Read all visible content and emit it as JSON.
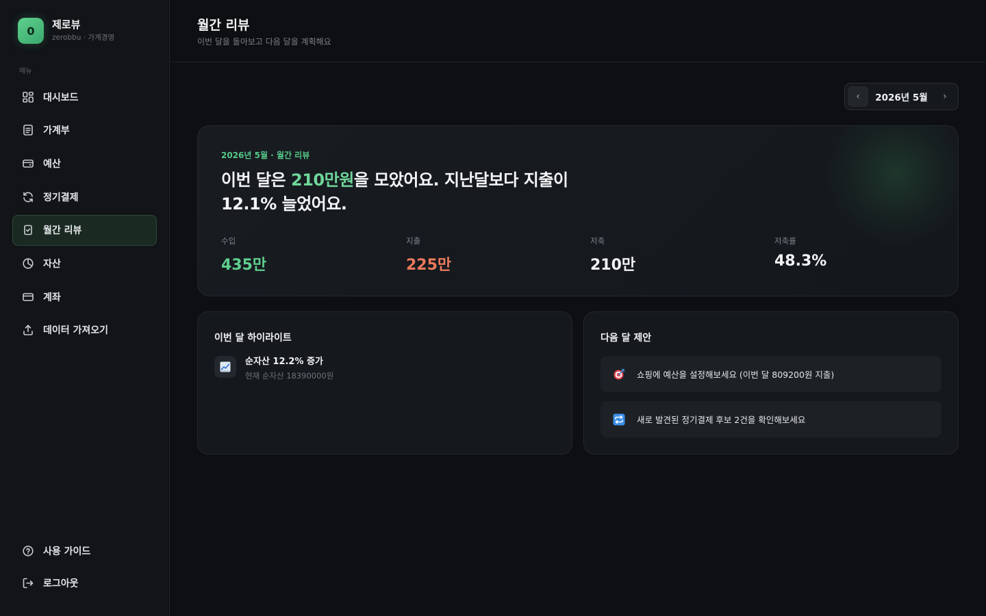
{
  "brand": {
    "logo_letter": "0",
    "name": "제로뷰",
    "subtitle": "zerobbu · 가계경영"
  },
  "sidebar": {
    "menu_label": "메뉴",
    "items": [
      {
        "label": "대시보드",
        "icon": "grid-icon"
      },
      {
        "label": "가계부",
        "icon": "ledger-icon"
      },
      {
        "label": "예산",
        "icon": "wallet-icon"
      },
      {
        "label": "정기결제",
        "icon": "refresh-icon"
      },
      {
        "label": "월간 리뷰",
        "icon": "checklist-icon",
        "active": true
      },
      {
        "label": "자산",
        "icon": "pie-icon"
      },
      {
        "label": "계좌",
        "icon": "card-icon"
      },
      {
        "label": "데이터 가져오기",
        "icon": "upload-icon"
      }
    ],
    "bottom_items": [
      {
        "label": "사용 가이드",
        "icon": "help-icon"
      },
      {
        "label": "로그아웃",
        "icon": "logout-icon"
      }
    ]
  },
  "header": {
    "title": "월간 리뷰",
    "subtitle": "이번 달을 돌아보고 다음 달을 계획해요"
  },
  "month_picker": {
    "label": "2026년 5월",
    "prev": "‹",
    "next": "›"
  },
  "hero": {
    "eyebrow": "2026년 5월 · 월간 리뷰",
    "headline_pre": "이번 달은 ",
    "headline_amount": "210만원",
    "headline_post": "을 모았어요. 지난달보다 지출이 12.1% 늘었어요.",
    "stats": [
      {
        "label": "수입",
        "value": "435만",
        "tone": "green"
      },
      {
        "label": "지출",
        "value": "225만",
        "tone": "red"
      },
      {
        "label": "저축",
        "value": "210만",
        "tone": "neutral"
      },
      {
        "label": "저축률",
        "value": "48.3%",
        "tone": "neutral"
      }
    ]
  },
  "highlights": {
    "title": "이번 달 하이라이트",
    "items": [
      {
        "icon": "chart-up-icon",
        "title": "순자산 12.2% 증가",
        "subtitle": "현재 순자산 18390000원"
      }
    ]
  },
  "suggestions": {
    "title": "다음 달 제안",
    "items": [
      {
        "icon": "target-icon",
        "text": "쇼핑에 예산을 설정해보세요 (이번 달 809200원 지출)"
      },
      {
        "icon": "repeat-icon",
        "text": "새로 발견된 정기결제 후보 2건을 확인해보세요"
      }
    ]
  },
  "colors": {
    "accent_green": "#5fcf8e",
    "expense_red": "#ec7a5c",
    "background": "#0d0f12"
  }
}
